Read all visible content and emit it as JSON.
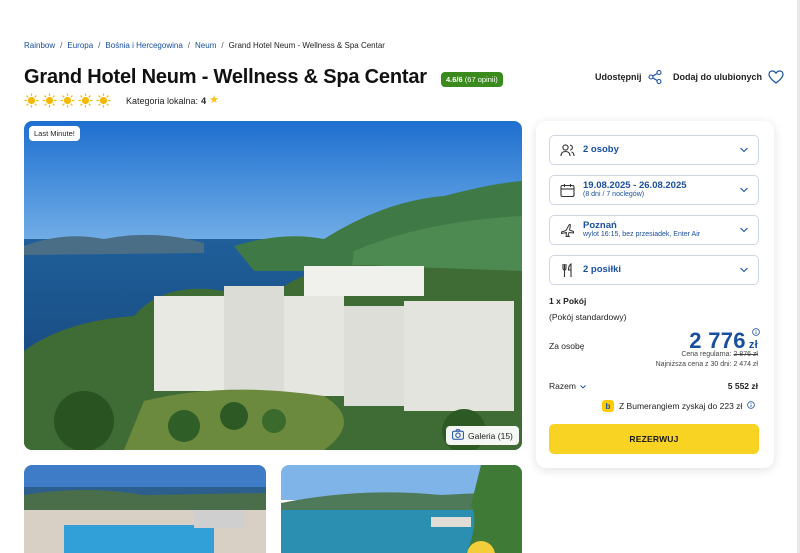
{
  "breadcrumb": {
    "items": [
      "Rainbow",
      "Europa",
      "Bośnia i Hercegowina",
      "Neum"
    ],
    "current": "Grand Hotel Neum - Wellness & Spa Centar",
    "separator": "/"
  },
  "hotel": {
    "title": "Grand Hotel Neum - Wellness & Spa Centar",
    "rating": "4.6/6",
    "rating_count": "(67 opinii)",
    "category_suns": 5,
    "local_category_label": "Kategoria lokalna:",
    "local_category_value": "4"
  },
  "actions": {
    "share": "Udostępnij",
    "favorite": "Dodaj do ulubionych"
  },
  "gallery": {
    "badge": "Last Minute!",
    "button": "Galeria (15)"
  },
  "booking": {
    "persons": {
      "label": "2 osoby"
    },
    "dates": {
      "label": "19.08.2025 - 26.08.2025",
      "sub": "(8 dni / 7 noclegów)"
    },
    "flight": {
      "label": "Poznań",
      "sub": "wylot 16:15, bez przesiadek, Enter Air"
    },
    "meals": {
      "label": "2 posiłki"
    },
    "room_count": "1 x Pokój",
    "room_type": "(Pokój standardowy)",
    "per_person_label": "Za osobę",
    "price": "2 776",
    "currency": "zł",
    "regular_label": "Cena regularna:",
    "regular_price": "2 876 zł",
    "lowest_label": "Najniższa cena z 30 dni:",
    "lowest_price": "2 474 zł",
    "total_label": "Razem",
    "total_value": "5 552 zł",
    "bumerang": "Z Bumerangiem zyskaj do 223 zł",
    "bumerang_logo": "b",
    "reserve": "REZERWUJ"
  },
  "colors": {
    "accent_blue": "#1a4fa0",
    "rating_green": "#3a8a1e",
    "cta_yellow": "#f9d324"
  }
}
